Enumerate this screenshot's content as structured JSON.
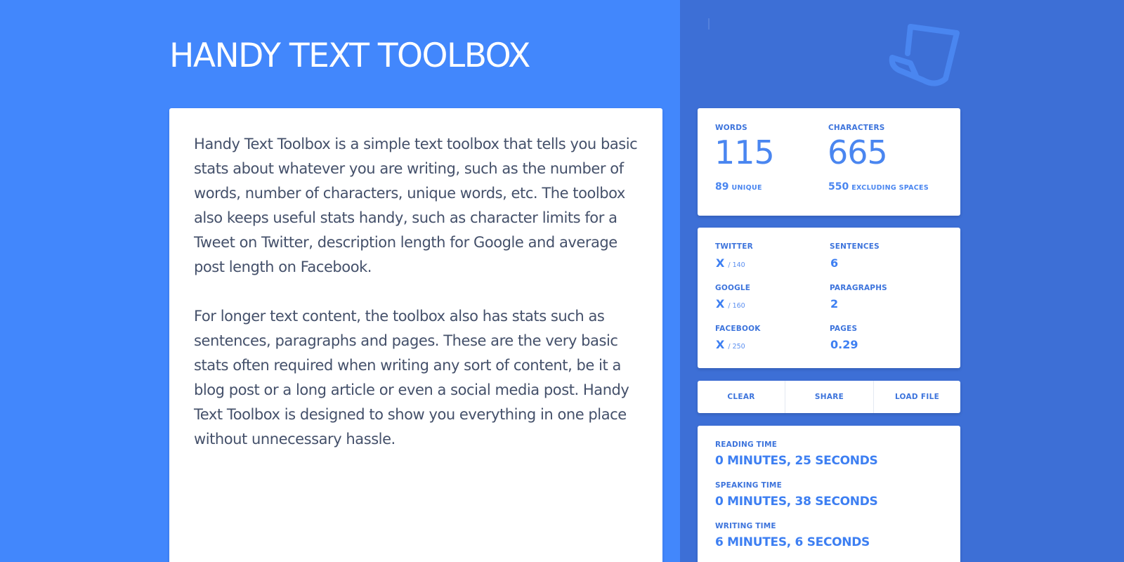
{
  "app": {
    "title": "HANDY TEXT TOOLBOX",
    "logo_icon": "document-logo-icon"
  },
  "editor": {
    "paragraphs": [
      "Handy Text Toolbox is a simple text toolbox that tells you basic stats about whatever you are writing, such as the number of words, number of characters, unique words, etc. The toolbox also keeps useful stats handy, such as character limits for a Tweet on Twitter, description length for Google and average post length on Facebook.",
      "For longer text content, the toolbox also has stats such as sentences, paragraphs and pages. These are the very basic stats often required when writing any sort of content, be it a blog post or a long article or even a social media post. Handy Text Toolbox is designed to show you everything in one place without unnecessary hassle."
    ]
  },
  "counts": {
    "words_label": "WORDS",
    "words_value": "115",
    "unique_value": "89",
    "unique_label": "UNIQUE",
    "characters_label": "CHARACTERS",
    "characters_value": "665",
    "excluding_value": "550",
    "excluding_label": "EXCLUDING SPACES"
  },
  "limits": {
    "twitter_label": "TWITTER",
    "twitter_value": "X",
    "twitter_limit": "/ 140",
    "google_label": "GOOGLE",
    "google_value": "X",
    "google_limit": "/ 160",
    "facebook_label": "FACEBOOK",
    "facebook_value": "X",
    "facebook_limit": "/ 250",
    "sentences_label": "SENTENCES",
    "sentences_value": "6",
    "paragraphs_label": "PARAGRAPHS",
    "paragraphs_value": "2",
    "pages_label": "PAGES",
    "pages_value": "0.29"
  },
  "actions": {
    "clear": "CLEAR",
    "share": "SHARE",
    "load_file": "LOAD FILE"
  },
  "times": {
    "reading_label": "READING TIME",
    "reading_value": "0 MINUTES, 25 SECONDS",
    "speaking_label": "SPEAKING TIME",
    "speaking_value": "0 MINUTES, 38 SECONDS",
    "writing_label": "WRITING TIME",
    "writing_value": "6 MINUTES, 6 SECONDS"
  },
  "colors": {
    "background_left": "#4287fc",
    "background_right": "#3d6fd6",
    "accent": "#4a86f0",
    "body_text": "#44506a"
  }
}
